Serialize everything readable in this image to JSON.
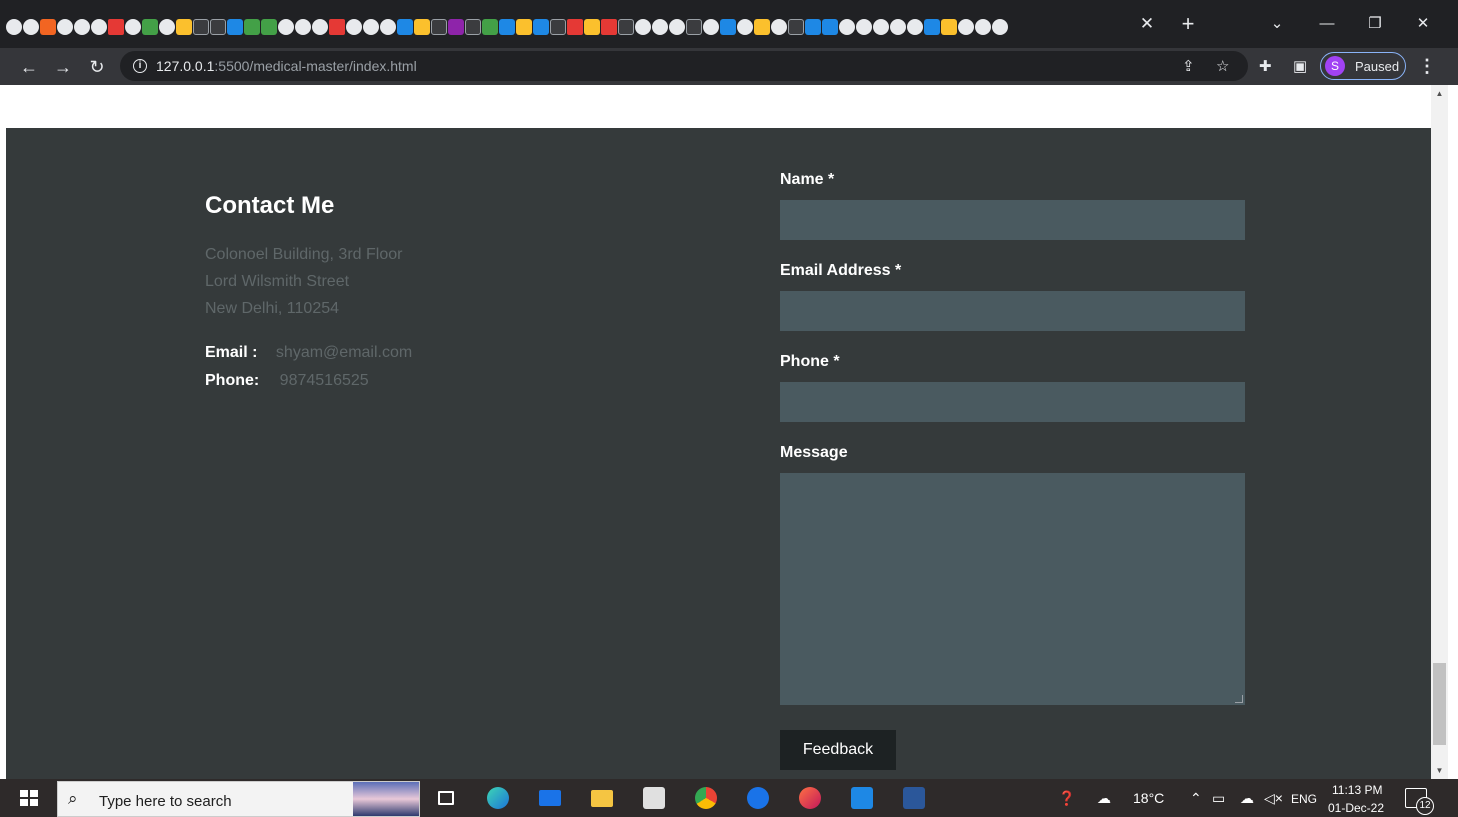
{
  "browser": {
    "tab_close_glyph": "✕",
    "new_tab_glyph": "+",
    "url_host": "127.0.0.1",
    "url_path": ":5500/medical-master/index.html",
    "profile_initial": "S",
    "profile_status": "Paused",
    "icons": {
      "back": "back-arrow-icon",
      "forward": "forward-arrow-icon",
      "reload": "reload-icon",
      "info": "info-icon",
      "share": "share-icon",
      "bookmark": "star-icon",
      "extensions": "puzzle-icon",
      "sidepanel": "side-panel-icon",
      "menu": "kebab-menu-icon"
    }
  },
  "contact": {
    "title": "Contact Me",
    "address": [
      "Colonoel Building, 3rd Floor",
      "Lord Wilsmith Street",
      "New Delhi, 110254"
    ],
    "email_label": "Email :",
    "email_value": "shyam@email.com",
    "phone_label": "Phone:",
    "phone_value": "9874516525"
  },
  "form": {
    "name_label": "Name *",
    "email_label": "Email Address *",
    "phone_label": "Phone *",
    "message_label": "Message",
    "submit_label": "Feedback",
    "name_value": "",
    "email_value": "",
    "phone_value": "",
    "message_value": ""
  },
  "taskbar": {
    "search_placeholder": "Type here to search",
    "weather": "18°C",
    "language": "ENG",
    "time": "11:13 PM",
    "date": "01-Dec-22",
    "notification_count": "12"
  },
  "colors": {
    "footer_bg": "#353a3b",
    "field_bg": "#4a5a60",
    "button_bg": "#1d2223",
    "muted_text": "#5f6769"
  }
}
